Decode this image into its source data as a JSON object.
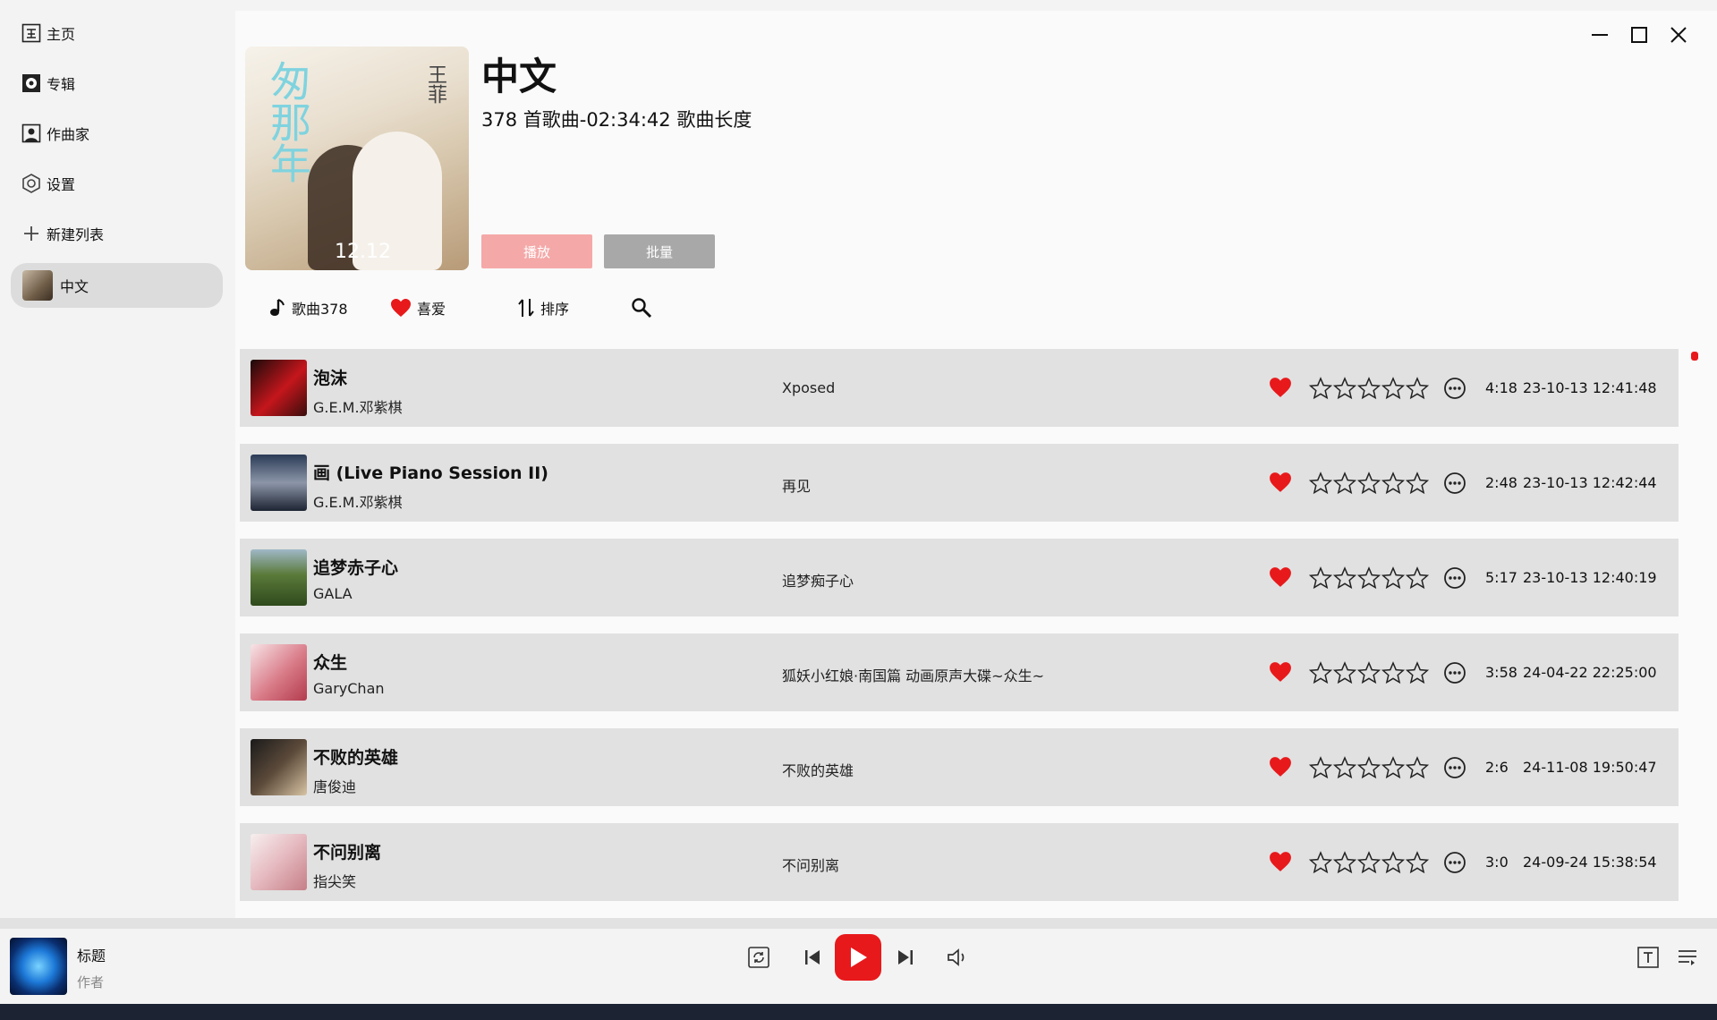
{
  "sidebar": {
    "items": [
      {
        "label": "主页",
        "icon": "home-icon"
      },
      {
        "label": "专辑",
        "icon": "album-icon"
      },
      {
        "label": "作曲家",
        "icon": "artist-icon"
      },
      {
        "label": "设置",
        "icon": "settings-icon"
      },
      {
        "label": "新建列表",
        "icon": "plus-icon"
      }
    ],
    "active_playlist": {
      "label": "中文"
    }
  },
  "playlist": {
    "cover_text": {
      "title_chars": "匆那年",
      "artist_chars": "王菲",
      "date": "12.12"
    },
    "title": "中文",
    "subtitle": "378 首歌曲-02:34:42 歌曲长度",
    "play_label": "播放",
    "batch_label": "批量"
  },
  "toolbar": {
    "songs_label": "歌曲378",
    "favorites_label": "喜爱",
    "sort_label": "排序"
  },
  "songs": [
    {
      "title": "泡沫",
      "artist": "G.E.M.邓紫棋",
      "album": "Xposed",
      "duration": "4:18",
      "date": "23-10-13 12:41:48",
      "liked": true,
      "rating": 0
    },
    {
      "title": "画 (Live Piano Session II)",
      "artist": "G.E.M.邓紫棋",
      "album": "再见",
      "duration": "2:48",
      "date": "23-10-13 12:42:44",
      "liked": true,
      "rating": 0
    },
    {
      "title": "追梦赤子心",
      "artist": "GALA",
      "album": "追梦痴子心",
      "duration": "5:17",
      "date": "23-10-13 12:40:19",
      "liked": true,
      "rating": 0
    },
    {
      "title": "众生",
      "artist": "GaryChan",
      "album": "狐妖小红娘·南国篇 动画原声大碟~众生~",
      "duration": "3:58",
      "date": "24-04-22 22:25:00",
      "liked": true,
      "rating": 0
    },
    {
      "title": "不败的英雄",
      "artist": "唐俊迪",
      "album": "不败的英雄",
      "duration": "2:6",
      "date": "24-11-08 19:50:47",
      "liked": true,
      "rating": 0
    },
    {
      "title": "不问别离",
      "artist": "指尖笑",
      "album": "不问别离",
      "duration": "3:0",
      "date": "24-09-24 15:38:54",
      "liked": true,
      "rating": 0
    }
  ],
  "player": {
    "title": "标题",
    "author": "作者"
  },
  "colors": {
    "accent": "#e8191b",
    "play_button": "#f5a8a8",
    "batch_button": "#a8a8a8",
    "row_bg": "#e1e1e1"
  }
}
